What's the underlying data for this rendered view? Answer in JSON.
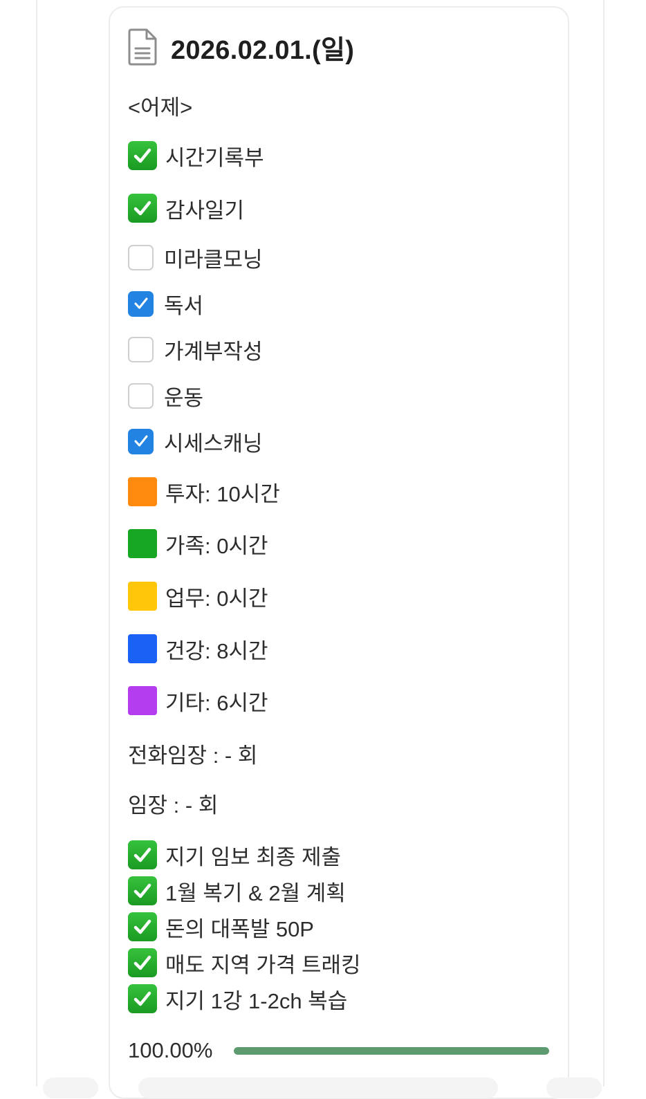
{
  "header": {
    "title": "2026.02.01.(일)",
    "icon": "document-icon"
  },
  "section_label": "<어제>",
  "habits": [
    {
      "label": "시간기록부",
      "style": "emoji",
      "checked": true
    },
    {
      "label": "감사일기",
      "style": "emoji",
      "checked": true
    },
    {
      "label": "미라클모닝",
      "style": "box",
      "checked": false
    },
    {
      "label": "독서",
      "style": "box",
      "checked": true
    },
    {
      "label": "가계부작성",
      "style": "box",
      "checked": false
    },
    {
      "label": "운동",
      "style": "box",
      "checked": false
    },
    {
      "label": "시세스캐닝",
      "style": "box",
      "checked": true
    }
  ],
  "time_categories": [
    {
      "label": "투자: 10시간",
      "color": "#ff8a0d"
    },
    {
      "label": "가족: 0시간",
      "color": "#18a625"
    },
    {
      "label": "업무: 0시간",
      "color": "#ffc60a"
    },
    {
      "label": "건강: 8시간",
      "color": "#1a62f5"
    },
    {
      "label": "기타: 6시간",
      "color": "#b53df0"
    }
  ],
  "calls": {
    "phone_visit": "전화임장 : - 회",
    "visit": "임장 : - 회"
  },
  "tasks": [
    "지기 임보 최종 제출",
    "1월 복기 & 2월 계획",
    "돈의 대폭발 50P",
    "매도 지역 가격 트래킹",
    "지기 1강 1-2ch 복습"
  ],
  "progress": {
    "label": "100.00%",
    "value": 1.0,
    "color": "#5d9a6f"
  }
}
